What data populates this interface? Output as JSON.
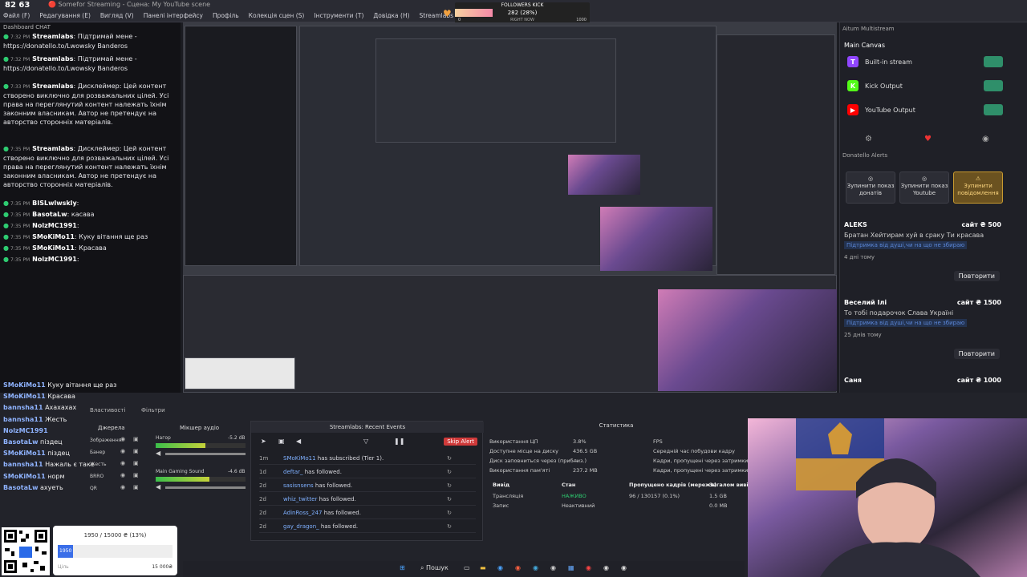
{
  "app": {
    "title": "🔴 Somefor Streaming - Сцена: My YouTube scene",
    "viewer_count": "82 63"
  },
  "menu": [
    "Файл (F)",
    "Редагування (E)",
    "Вигляд (V)",
    "Панелі інтерфейсу",
    "Профіль",
    "Колекція сцен (S)",
    "Інструменти (T)",
    "Довідка (H)",
    "Streamlabs"
  ],
  "followers_goal": {
    "label": "FOLLOWERS KICK",
    "value_text": "282 (28%)",
    "progress": 0.28,
    "sub": "RIGHT NOW",
    "min": "0",
    "max": "1000"
  },
  "chat": {
    "title": "Dashboard CHAT",
    "messages": [
      {
        "time": "7:32 PM",
        "user": "Streamlabs",
        "text": "Підтримай мене - https://donatello.to/Lwowsky Banderos"
      },
      {
        "time": "7:32 PM",
        "user": "Streamlabs",
        "text": "Підтримай мене - https://donatello.to/Lwowsky Banderos"
      },
      {
        "time": "7:33 PM",
        "user": "Streamlabs",
        "text": "Дисклеймер: Цей контент створено виключно для розважальних цілей. Усі права на переглянутий контент належать їхнім законним власникам. Автор не претендує на авторство сторонніх матеріалів."
      },
      {
        "time": "7:35 PM",
        "user": "Streamlabs",
        "text": "Дисклеймер: Цей контент створено виключно для розважальних цілей. Усі права на переглянутий контент належать їхнім законним власникам. Автор не претендує на авторство сторонніх матеріалів."
      },
      {
        "time": "7:35 PM",
        "user": "BISLwlwskly",
        "text": ""
      },
      {
        "time": "7:35 PM",
        "user": "BasotaLw",
        "text": "касава"
      },
      {
        "time": "7:35 PM",
        "user": "NolzMC1991",
        "text": ""
      },
      {
        "time": "7:35 PM",
        "user": "SMoKiMo11",
        "text": "Куку вітання ще раз"
      },
      {
        "time": "7:35 PM",
        "user": "SMoKiMo11",
        "text": "Красава"
      },
      {
        "time": "7:35 PM",
        "user": "NolzMC1991",
        "text": ""
      }
    ]
  },
  "bottom_chat": [
    {
      "user": "SMoKiMo11",
      "text": "Куку вітання ще раз"
    },
    {
      "user": "SMoKiMo11",
      "text": "Красава"
    },
    {
      "user": "bannsha11",
      "text": "Ахахахах"
    },
    {
      "user": "bannsha11",
      "text": "Жесть"
    },
    {
      "user": "NolzMC1991",
      "text": ""
    },
    {
      "user": "BasotaLw",
      "text": "піздец"
    },
    {
      "user": "SMoKiMo11",
      "text": "піздец"
    },
    {
      "user": "bannsha11",
      "text": "Нажаль є таке"
    },
    {
      "user": "SMoKiMo11",
      "text": "норм"
    },
    {
      "user": "BasotaLw",
      "text": "ахуеть"
    }
  ],
  "dock": {
    "multistream_title": "Aitum Multistream",
    "main_canvas": "Main Canvas",
    "outputs": [
      {
        "name": "Built-in stream",
        "icon": "twitch-icon",
        "color": "#9146ff",
        "glyph": "T"
      },
      {
        "name": "Kick Output",
        "icon": "kick-icon",
        "color": "#53fc18",
        "glyph": "K"
      },
      {
        "name": "YouTube Output",
        "icon": "youtube-icon",
        "color": "#ff0000",
        "glyph": "▶"
      }
    ],
    "alerts_title": "Donatello Alerts",
    "buttons": [
      "Зупинити показ донатів",
      "Зупинити показ Youtube",
      "Зупинити повідомлення"
    ],
    "alerts": [
      {
        "name": "ALEKS",
        "amount": "сайт ₴ 500",
        "message": "Братан Хейтирам хуй в сраку Ти красава",
        "tag": "Підтримка від душі,чи на що не збираю",
        "time": "4 дні тому",
        "replay": "Повторити"
      },
      {
        "name": "Веселий Ілі",
        "amount": "сайт ₴ 1500",
        "message": "То тобі подарочок Слава Україні",
        "tag": "Підтримка від душі,чи на що не збираю",
        "time": "25 днів тому",
        "replay": "Повторити"
      },
      {
        "name": "Саня",
        "amount": "сайт ₴ 1000",
        "message": "",
        "tag": "",
        "time": "",
        "replay": ""
      }
    ]
  },
  "panels": {
    "properties": "Властивості",
    "filters": "Фільтри",
    "sources_title": "Джерела",
    "mixer_title": "Мікшер аудіо",
    "scenes": [
      "Зображення",
      "Банер",
      "Жесть",
      "BRRO",
      "QR"
    ],
    "mixer_channels": [
      {
        "name": "Нагор",
        "db": "-5.2 dB",
        "level": 0.55
      },
      {
        "name": "Main Gaming Sound",
        "db": "-4.6 dB",
        "level": 0.6
      }
    ]
  },
  "recent_events": {
    "title": "Streamlabs: Recent Events",
    "skip_label": "Skip Alert",
    "events": [
      {
        "ago": "1m",
        "user": "SMoKiMo11",
        "action": "has subscribed (Tier 1)."
      },
      {
        "ago": "1d",
        "user": "deftar_",
        "action": "has followed."
      },
      {
        "ago": "2d",
        "user": "sasisnsens",
        "action": "has followed."
      },
      {
        "ago": "2d",
        "user": "whiz_twitter",
        "action": "has followed."
      },
      {
        "ago": "2d",
        "user": "AdinRoss_247",
        "action": "has followed."
      },
      {
        "ago": "2d",
        "user": "gay_dragon_",
        "action": "has followed."
      }
    ]
  },
  "stats": {
    "title": "Статистика",
    "rows_left": [
      {
        "label": "Використання ЦП",
        "value": "3.8%"
      },
      {
        "label": "Доступне місце на диску",
        "value": "436.5 GB"
      },
      {
        "label": "Диск заповниться через (приблиз.)",
        "value": "—"
      },
      {
        "label": "Використання пам'яті",
        "value": "237.2 MB"
      }
    ],
    "rows_right": [
      {
        "label": "FPS",
        "value": "60.00"
      },
      {
        "label": "Середній час побудови кадру",
        "value": "0.8 ms"
      },
      {
        "label": "Кадри, пропущені через затримки ре",
        "value": ""
      },
      {
        "label": "Кадри, пропущені через затримки ре",
        "value": ""
      }
    ],
    "table_head": [
      "Вивід",
      "Стан",
      "Пропущено кадрів (мережа)",
      "Загалом вивід"
    ],
    "table_rows": [
      [
        "Трансляція",
        "НАЖИВО",
        "96 / 130157 (0.1%)",
        "1.5 GB"
      ],
      [
        "Запис",
        "Неактивний",
        "",
        "0.0 MB"
      ]
    ]
  },
  "donation_goal": {
    "text": "1950 / 15000 ₴ (13%)",
    "progress": 0.13,
    "fill_text": "1950",
    "min": "Ціль",
    "max": "15 000₴"
  },
  "taskbar": {
    "search": "Пошук"
  }
}
